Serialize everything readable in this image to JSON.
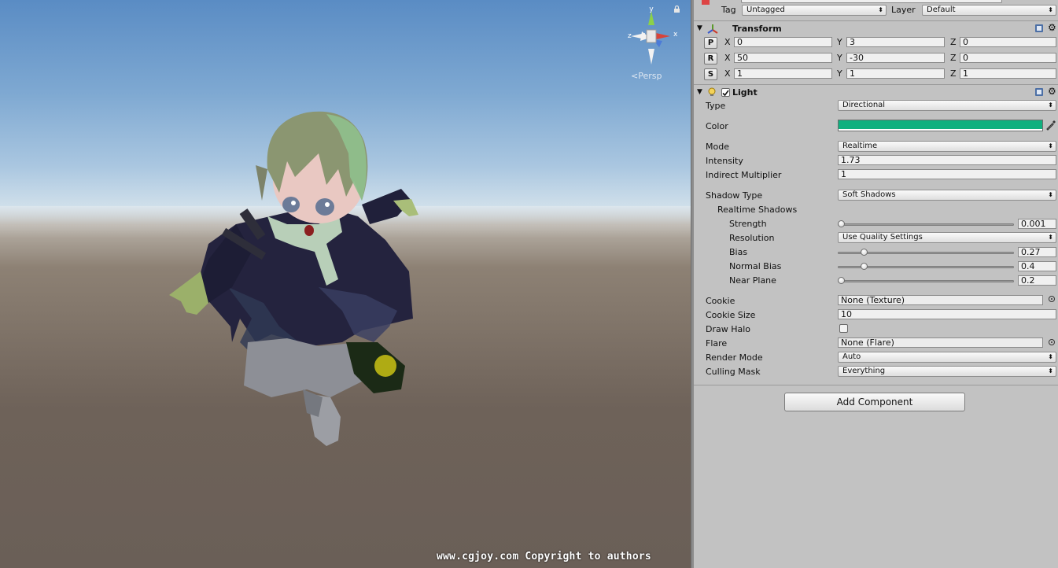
{
  "scene": {
    "persp_label": "Persp",
    "watermark": "www.cgjoy.com Copyright to authors",
    "gizmo": {
      "x": "x",
      "y": "y",
      "z": "z"
    }
  },
  "inspector": {
    "tag_label": "Tag",
    "tag_value": "Untagged",
    "layer_label": "Layer",
    "layer_value": "Default",
    "transform": {
      "title": "Transform",
      "rows": [
        {
          "btn": "P",
          "x": "0",
          "y": "3",
          "z": "0"
        },
        {
          "btn": "R",
          "x": "50",
          "y": "-30",
          "z": "0"
        },
        {
          "btn": "S",
          "x": "1",
          "y": "1",
          "z": "1"
        }
      ],
      "axis": {
        "x": "X",
        "y": "Y",
        "z": "Z"
      }
    },
    "light": {
      "title": "Light",
      "enabled": true,
      "type_label": "Type",
      "type_value": "Directional",
      "color_label": "Color",
      "color_value": "#10b07f",
      "mode_label": "Mode",
      "mode_value": "Realtime",
      "intensity_label": "Intensity",
      "intensity_value": "1.73",
      "indirect_label": "Indirect Multiplier",
      "indirect_value": "1",
      "shadow_type_label": "Shadow Type",
      "shadow_type_value": "Soft Shadows",
      "realtime_shadows_label": "Realtime Shadows",
      "strength_label": "Strength",
      "strength_value": "0.001",
      "strength_fraction": 0.001,
      "resolution_label": "Resolution",
      "resolution_value": "Use Quality Settings",
      "bias_label": "Bias",
      "bias_value": "0.27",
      "bias_fraction": 0.135,
      "normal_bias_label": "Normal Bias",
      "normal_bias_value": "0.4",
      "normal_bias_fraction": 0.133,
      "near_plane_label": "Near Plane",
      "near_plane_value": "0.2",
      "near_plane_fraction": 0.0,
      "cookie_label": "Cookie",
      "cookie_value": "None (Texture)",
      "cookie_size_label": "Cookie Size",
      "cookie_size_value": "10",
      "draw_halo_label": "Draw Halo",
      "draw_halo_checked": false,
      "flare_label": "Flare",
      "flare_value": "None (Flare)",
      "render_mode_label": "Render Mode",
      "render_mode_value": "Auto",
      "culling_mask_label": "Culling Mask",
      "culling_mask_value": "Everything"
    },
    "add_component_label": "Add Component"
  }
}
